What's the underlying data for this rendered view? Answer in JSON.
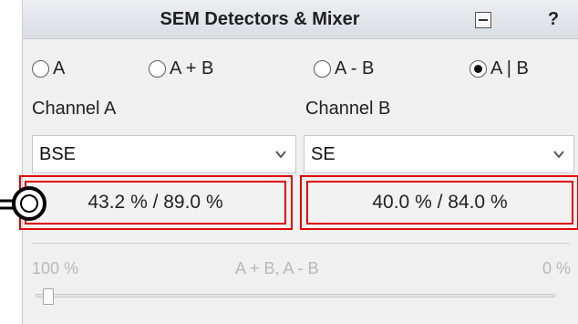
{
  "window": {
    "title": "SEM Detectors & Mixer",
    "help_label": "?"
  },
  "radios": [
    {
      "label": "A",
      "checked": false
    },
    {
      "label": "A + B",
      "checked": false
    },
    {
      "label": "A - B",
      "checked": false
    },
    {
      "label": "A | B",
      "checked": true
    }
  ],
  "channel_a": {
    "label": "Channel A",
    "selected": "BSE",
    "values": "43.2 % / 89.0 %"
  },
  "channel_b": {
    "label": "Channel B",
    "selected": "SE",
    "values": "40.0 % / 84.0 %"
  },
  "mixer": {
    "scale_left": "100 %",
    "scale_mid": "A + B, A - B",
    "scale_right": "0 %",
    "slider_position_fraction": 0.02
  },
  "colors": {
    "highlight": "#e00000",
    "disabled_text": "#b9b9b9"
  }
}
